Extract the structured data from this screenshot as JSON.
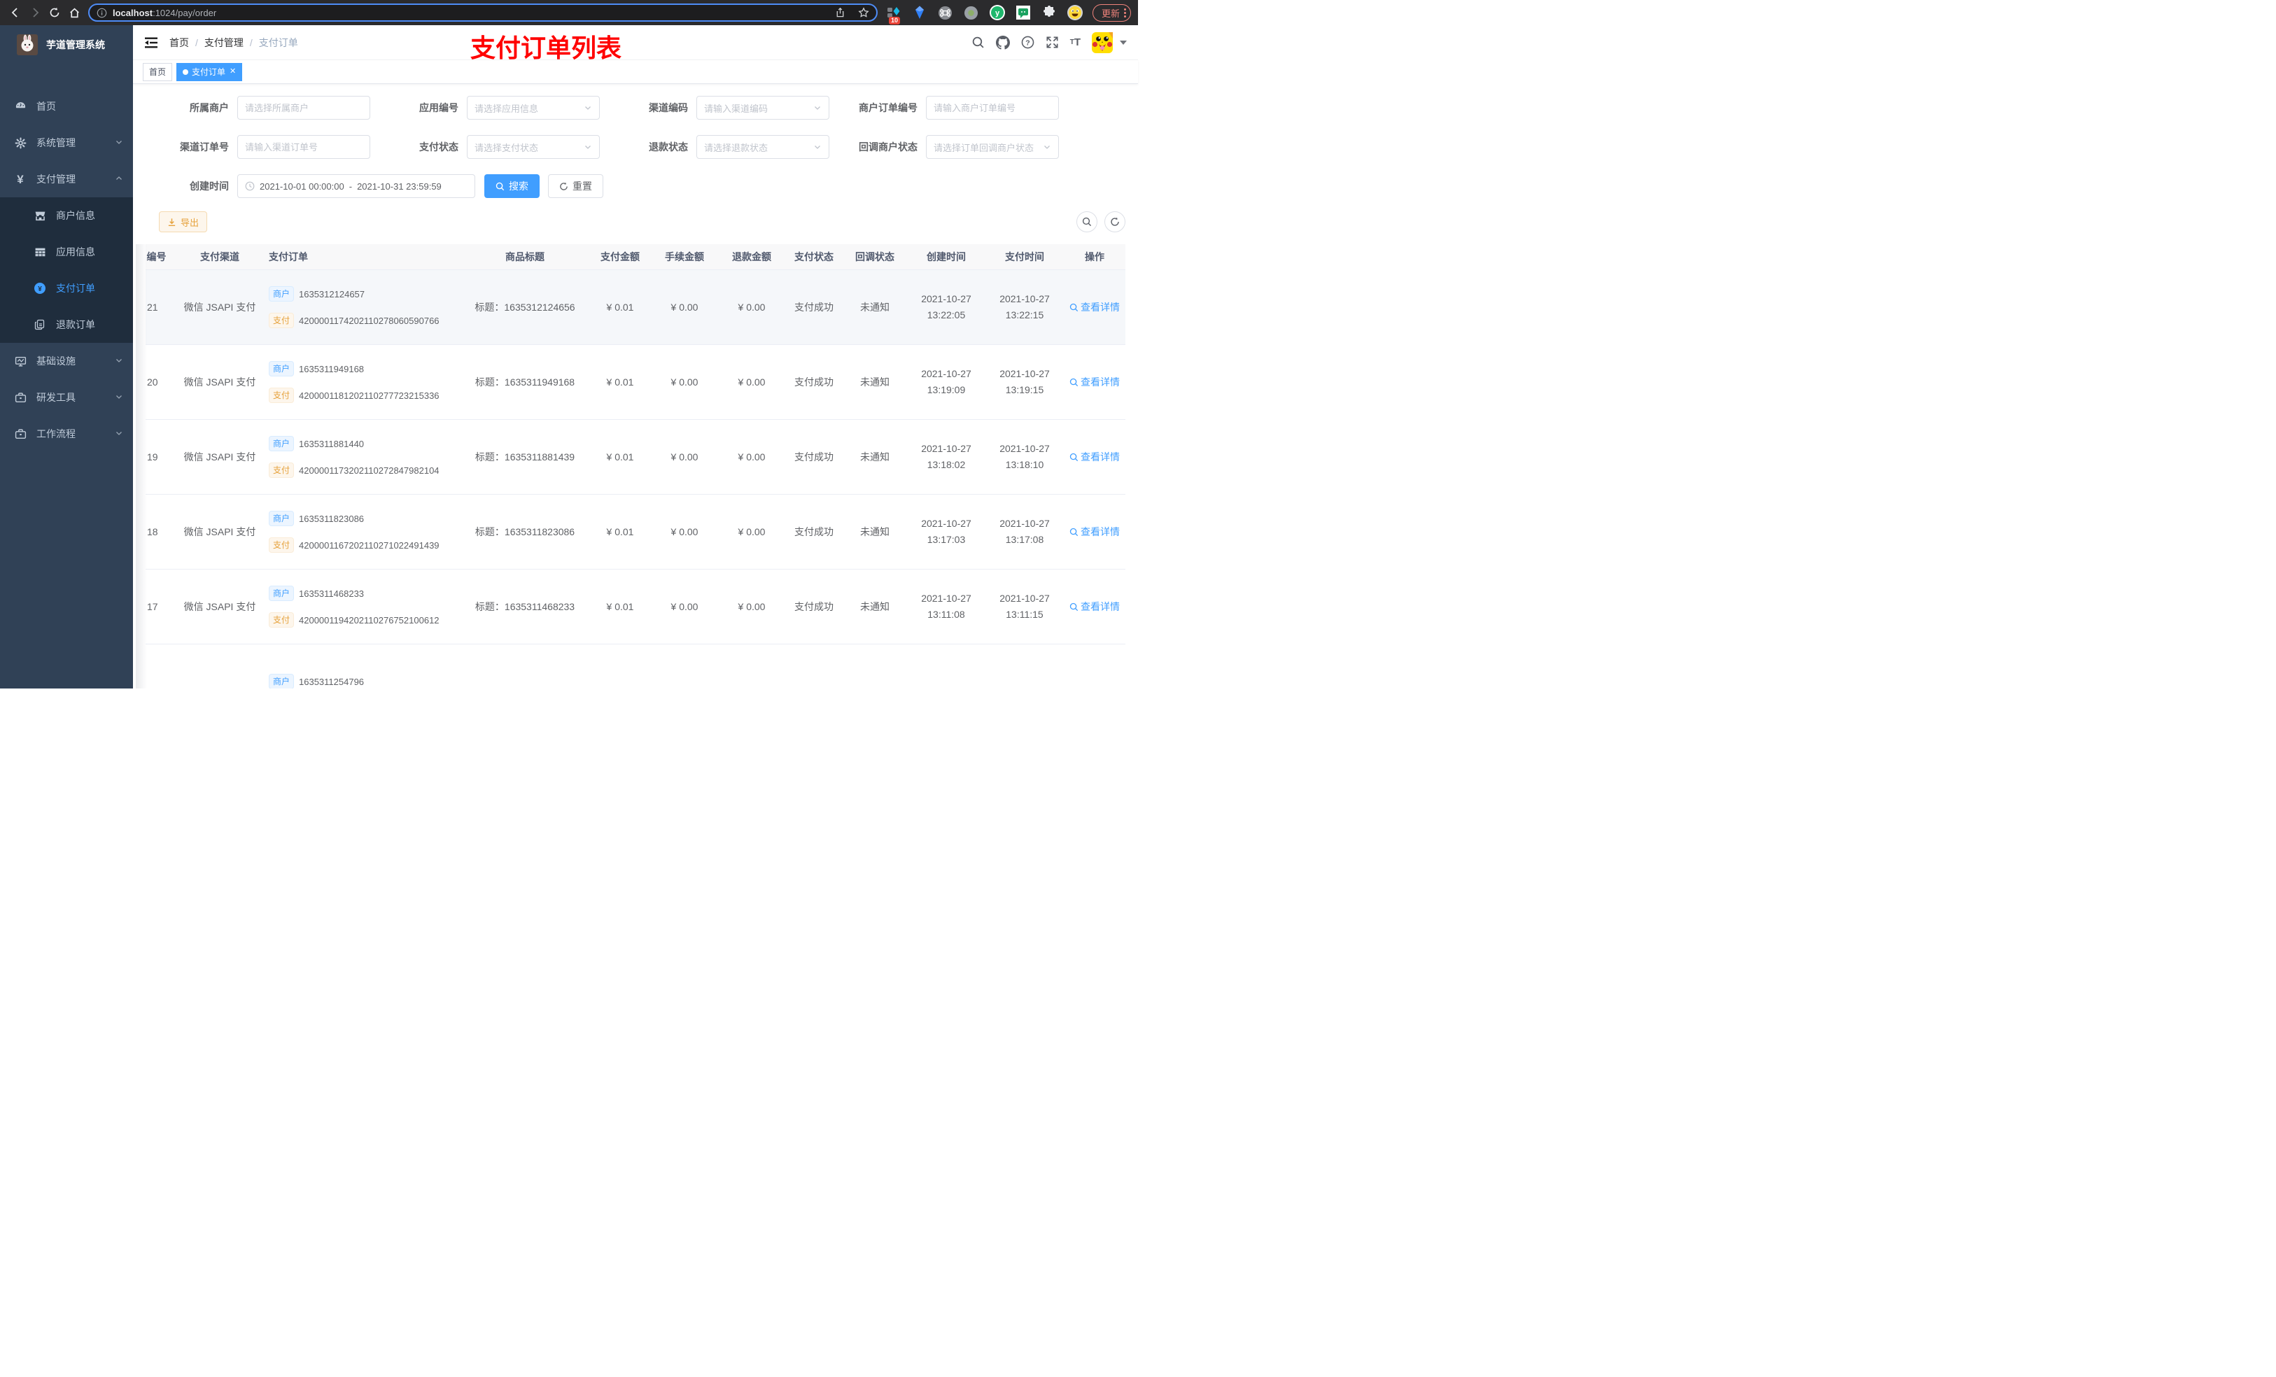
{
  "browser": {
    "url": {
      "host": "localhost",
      "rest": ":1024/pay/order"
    },
    "update_label": "更新",
    "extension_badge": "10"
  },
  "sidebar": {
    "title": "芋道管理系统",
    "menu": [
      {
        "label": "首页"
      },
      {
        "label": "系统管理"
      },
      {
        "label": "支付管理"
      },
      {
        "label": "商户信息"
      },
      {
        "label": "应用信息"
      },
      {
        "label": "支付订单"
      },
      {
        "label": "退款订单"
      },
      {
        "label": "基础设施"
      },
      {
        "label": "研发工具"
      },
      {
        "label": "工作流程"
      }
    ]
  },
  "topbar": {
    "breadcrumb": {
      "home": "首页",
      "section": "支付管理",
      "current": "支付订单"
    },
    "annotation": "支付订单列表"
  },
  "tabs": {
    "home": "首页",
    "current": "支付订单"
  },
  "filters": {
    "owner": {
      "label": "所属商户",
      "placeholder": "请选择所属商户"
    },
    "app": {
      "label": "应用编号",
      "placeholder": "请选择应用信息"
    },
    "channel_code": {
      "label": "渠道编码",
      "placeholder": "请输入渠道编码"
    },
    "merchant_order_no": {
      "label": "商户订单编号",
      "placeholder": "请输入商户订单编号"
    },
    "channel_order_no": {
      "label": "渠道订单号",
      "placeholder": "请输入渠道订单号"
    },
    "pay_status": {
      "label": "支付状态",
      "placeholder": "请选择支付状态"
    },
    "refund_status": {
      "label": "退款状态",
      "placeholder": "请选择退款状态"
    },
    "notify_status": {
      "label": "回调商户状态",
      "placeholder": "请选择订单回调商户状态"
    },
    "create_time": {
      "label": "创建时间",
      "start": "2021-10-01 00:00:00",
      "separator": "-",
      "end": "2021-10-31 23:59:59"
    },
    "search_label": "搜索",
    "reset_label": "重置"
  },
  "toolbar": {
    "export_label": "导出"
  },
  "table": {
    "columns": [
      "编号",
      "支付渠道",
      "支付订单",
      "商品标题",
      "支付金额",
      "手续金额",
      "退款金额",
      "支付状态",
      "回调状态",
      "创建时间",
      "支付时间",
      "操作"
    ],
    "tag_merchant": "商户",
    "tag_pay": "支付",
    "action_label": "查看详情",
    "rows": [
      {
        "id": "21",
        "channel": "微信 JSAPI 支付",
        "merchant_no": "1635312124657",
        "pay_no": "4200001174202110278060590766",
        "title": "标题：1635312124656",
        "amount": "¥ 0.01",
        "fee": "¥ 0.00",
        "refund": "¥ 0.00",
        "status": "支付成功",
        "notify": "未通知",
        "create_date": "2021-10-27",
        "create_time": "13:22:05",
        "pay_date": "2021-10-27",
        "pay_time": "13:22:15"
      },
      {
        "id": "20",
        "channel": "微信 JSAPI 支付",
        "merchant_no": "1635311949168",
        "pay_no": "4200001181202110277723215336",
        "title": "标题：1635311949168",
        "amount": "¥ 0.01",
        "fee": "¥ 0.00",
        "refund": "¥ 0.00",
        "status": "支付成功",
        "notify": "未通知",
        "create_date": "2021-10-27",
        "create_time": "13:19:09",
        "pay_date": "2021-10-27",
        "pay_time": "13:19:15"
      },
      {
        "id": "19",
        "channel": "微信 JSAPI 支付",
        "merchant_no": "1635311881440",
        "pay_no": "4200001173202110272847982104",
        "title": "标题：1635311881439",
        "amount": "¥ 0.01",
        "fee": "¥ 0.00",
        "refund": "¥ 0.00",
        "status": "支付成功",
        "notify": "未通知",
        "create_date": "2021-10-27",
        "create_time": "13:18:02",
        "pay_date": "2021-10-27",
        "pay_time": "13:18:10"
      },
      {
        "id": "18",
        "channel": "微信 JSAPI 支付",
        "merchant_no": "1635311823086",
        "pay_no": "4200001167202110271022491439",
        "title": "标题：1635311823086",
        "amount": "¥ 0.01",
        "fee": "¥ 0.00",
        "refund": "¥ 0.00",
        "status": "支付成功",
        "notify": "未通知",
        "create_date": "2021-10-27",
        "create_time": "13:17:03",
        "pay_date": "2021-10-27",
        "pay_time": "13:17:08"
      },
      {
        "id": "17",
        "channel": "微信 JSAPI 支付",
        "merchant_no": "1635311468233",
        "pay_no": "4200001194202110276752100612",
        "title": "标题：1635311468233",
        "amount": "¥ 0.01",
        "fee": "¥ 0.00",
        "refund": "¥ 0.00",
        "status": "支付成功",
        "notify": "未通知",
        "create_date": "2021-10-27",
        "create_time": "13:11:08",
        "pay_date": "2021-10-27",
        "pay_time": "13:11:15"
      },
      {
        "merchant_no": "1635311254796"
      }
    ]
  }
}
